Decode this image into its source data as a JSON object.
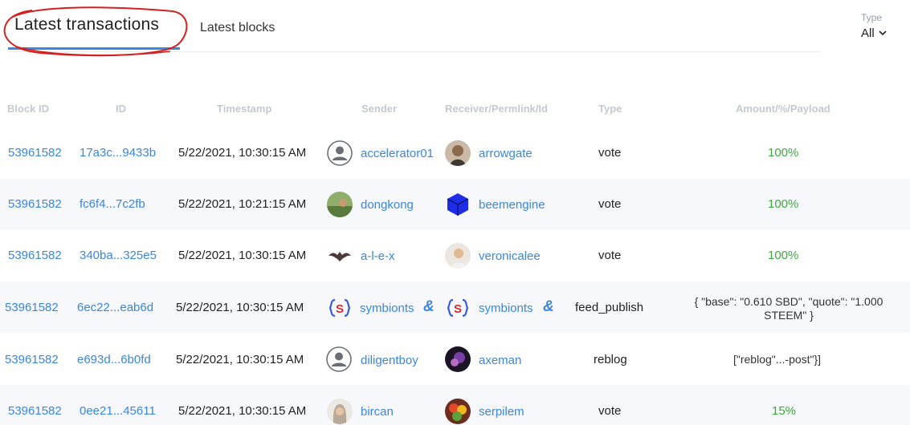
{
  "tabs": {
    "active": "Latest transactions",
    "second": "Latest blocks"
  },
  "type_filter": {
    "label": "Type",
    "value": "All"
  },
  "columns": {
    "block_id": "Block ID",
    "id": "ID",
    "timestamp": "Timestamp",
    "sender": "Sender",
    "receiver": "Receiver/Permlink/Id",
    "type": "Type",
    "amount": "Amount/%/Payload"
  },
  "colors": {
    "accent": "#3a86e0",
    "positive": "#3aa83a",
    "annotation": "#d62020"
  },
  "rows": [
    {
      "block": "53961582",
      "id": "17a3c...9433b",
      "time": "5/22/2021, 10:30:15 AM",
      "sender": "accelerator01",
      "receiver": "arrowgate",
      "type": "vote",
      "amount": "100%"
    },
    {
      "block": "53961582",
      "id": "fc6f4...7c2fb",
      "time": "5/22/2021, 10:21:15 AM",
      "sender": "dongkong",
      "receiver": "beemengine",
      "type": "vote",
      "amount": "100%"
    },
    {
      "block": "53961582",
      "id": "340ba...325e5",
      "time": "5/22/2021, 10:30:15 AM",
      "sender": "a-l-e-x",
      "receiver": "veronicalee",
      "type": "vote",
      "amount": "100%"
    },
    {
      "block": "53961582",
      "id": "6ec22...eab6d",
      "time": "5/22/2021, 10:30:15 AM",
      "sender": "symbionts",
      "receiver": "symbionts",
      "type": "feed_publish",
      "amount": "{ \"base\": \"0.610 SBD\", \"quote\": \"1.000",
      "amount_2": "STEEM\" }"
    },
    {
      "block": "53961582",
      "id": "e693d...6b0fd",
      "time": "5/22/2021, 10:30:15 AM",
      "sender": "diligentboy",
      "receiver": "axeman",
      "type": "reblog",
      "amount": "[\"reblog\"...-post\"}]"
    },
    {
      "block": "53961582",
      "id": "0ee21...45611",
      "time": "5/22/2021, 10:30:15 AM",
      "sender": "bircan",
      "receiver": "serpilem",
      "type": "vote",
      "amount": "15%"
    }
  ]
}
